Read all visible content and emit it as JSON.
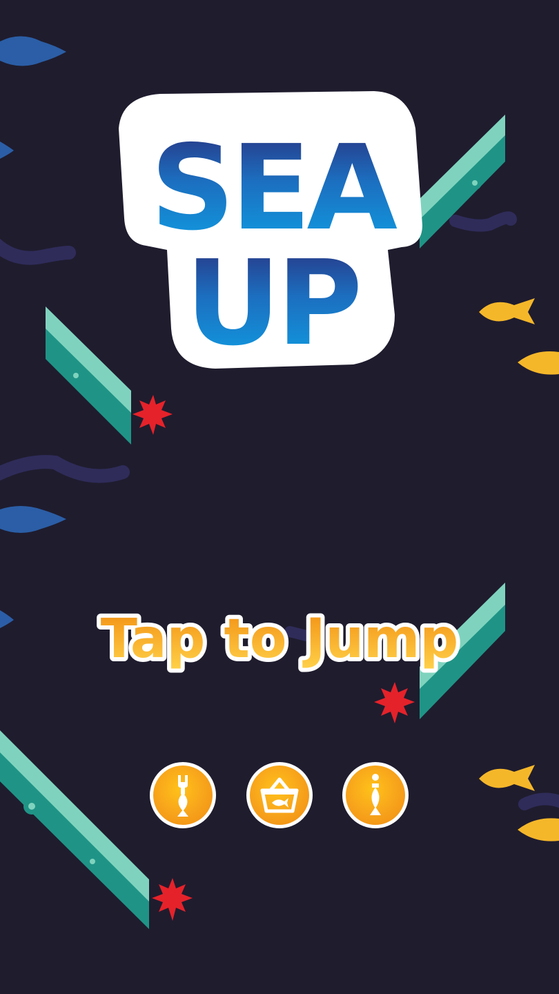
{
  "game": {
    "title_line1": "SEA",
    "title_line2": "UP",
    "prompt": "Tap to Jump"
  },
  "buttons": [
    {
      "id": "tools",
      "icon": "fish-bone-icon",
      "label": "Tools"
    },
    {
      "id": "shop",
      "icon": "shop-basket-icon",
      "label": "Shop"
    },
    {
      "id": "info",
      "icon": "info-fish-icon",
      "label": "Info"
    }
  ],
  "colors": {
    "background": "#1f1c2e",
    "ramp_light": "#7fd3be",
    "ramp_dark": "#1f9486",
    "spike": "#e5222a",
    "fish_blue": "#2b5ea6",
    "fish_yellow": "#f5b72a",
    "wave": "#2f2c5a",
    "title_top": "#2a2c7a",
    "title_bottom": "#0ea2e6",
    "prompt_top": "#f7a81b",
    "prompt_bottom": "#ffd24a",
    "button": "#f7a21b"
  }
}
